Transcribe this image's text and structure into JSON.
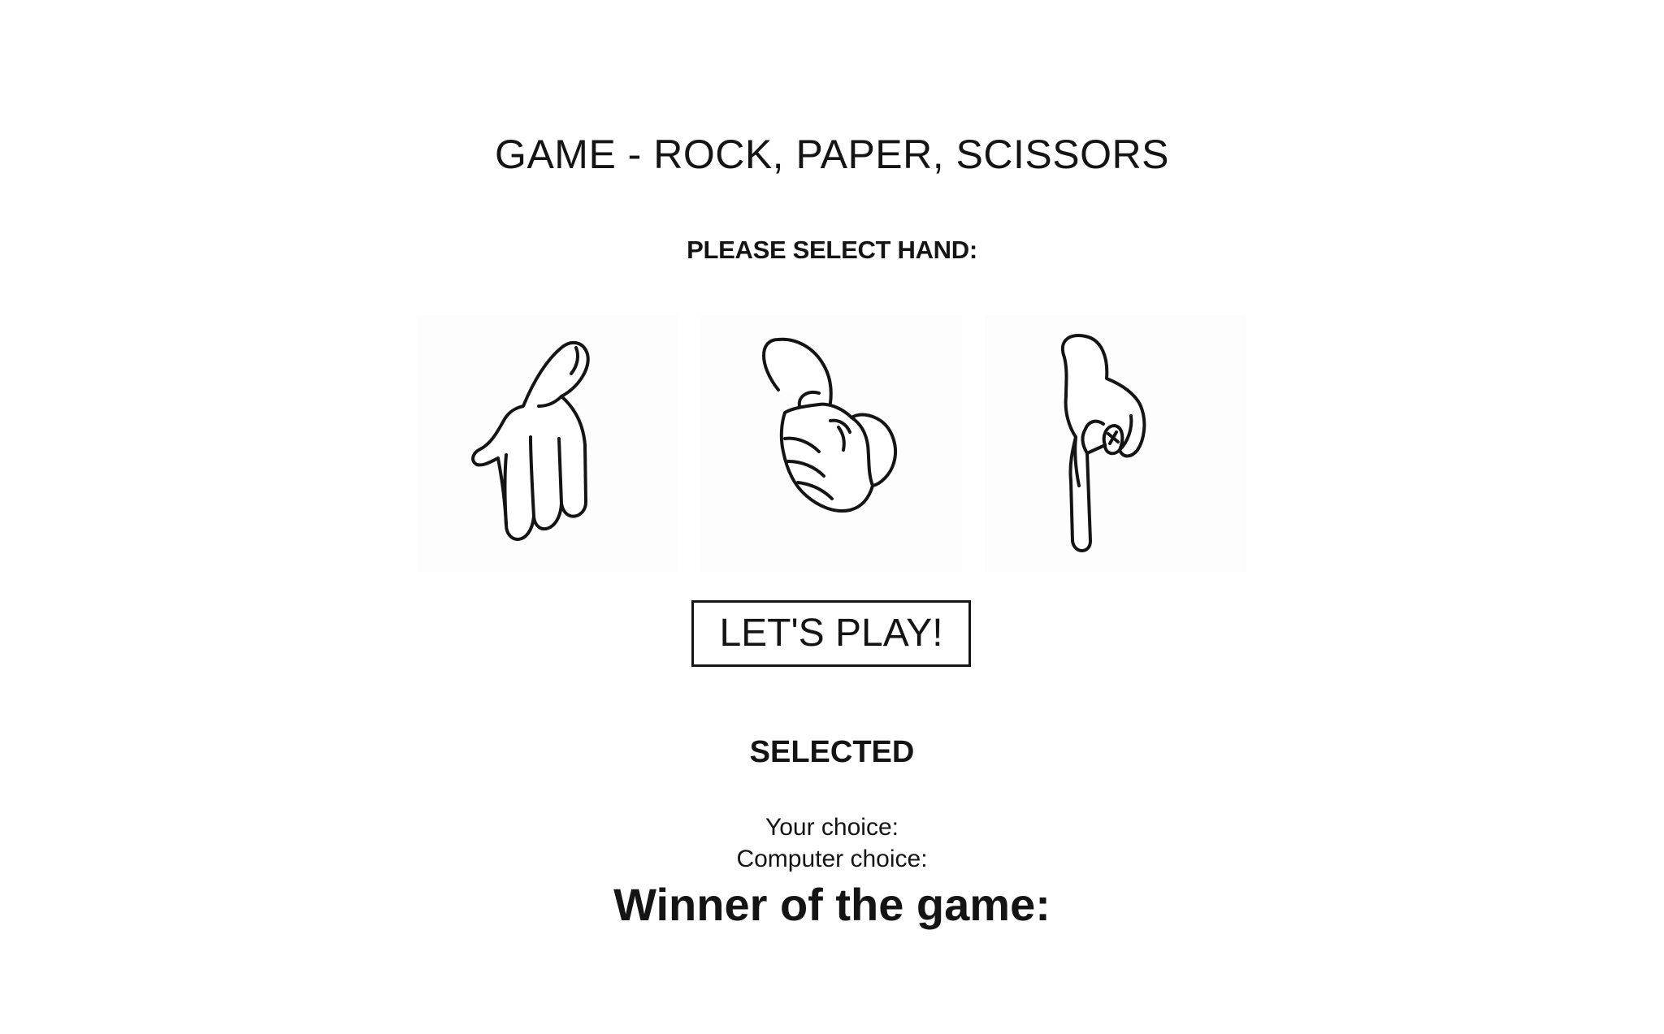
{
  "game": {
    "title": "GAME - ROCK, PAPER, SCISSORS",
    "prompt": "PLEASE SELECT HAND:",
    "hands": [
      {
        "id": "paper",
        "icon": "paper-hand-icon"
      },
      {
        "id": "rock",
        "icon": "rock-fist-icon"
      },
      {
        "id": "scissors",
        "icon": "scissors-hand-icon"
      }
    ],
    "play_button_label": "LET'S PLAY!",
    "selected_heading": "SELECTED",
    "your_choice_label": "Your choice:",
    "your_choice_value": "",
    "computer_choice_label": "Computer choice:",
    "computer_choice_value": "",
    "winner_label": "Winner of the game:",
    "winner_value": ""
  },
  "colors": {
    "ink": "#141414",
    "background": "#ffffff",
    "card": "#fdfdfd"
  }
}
